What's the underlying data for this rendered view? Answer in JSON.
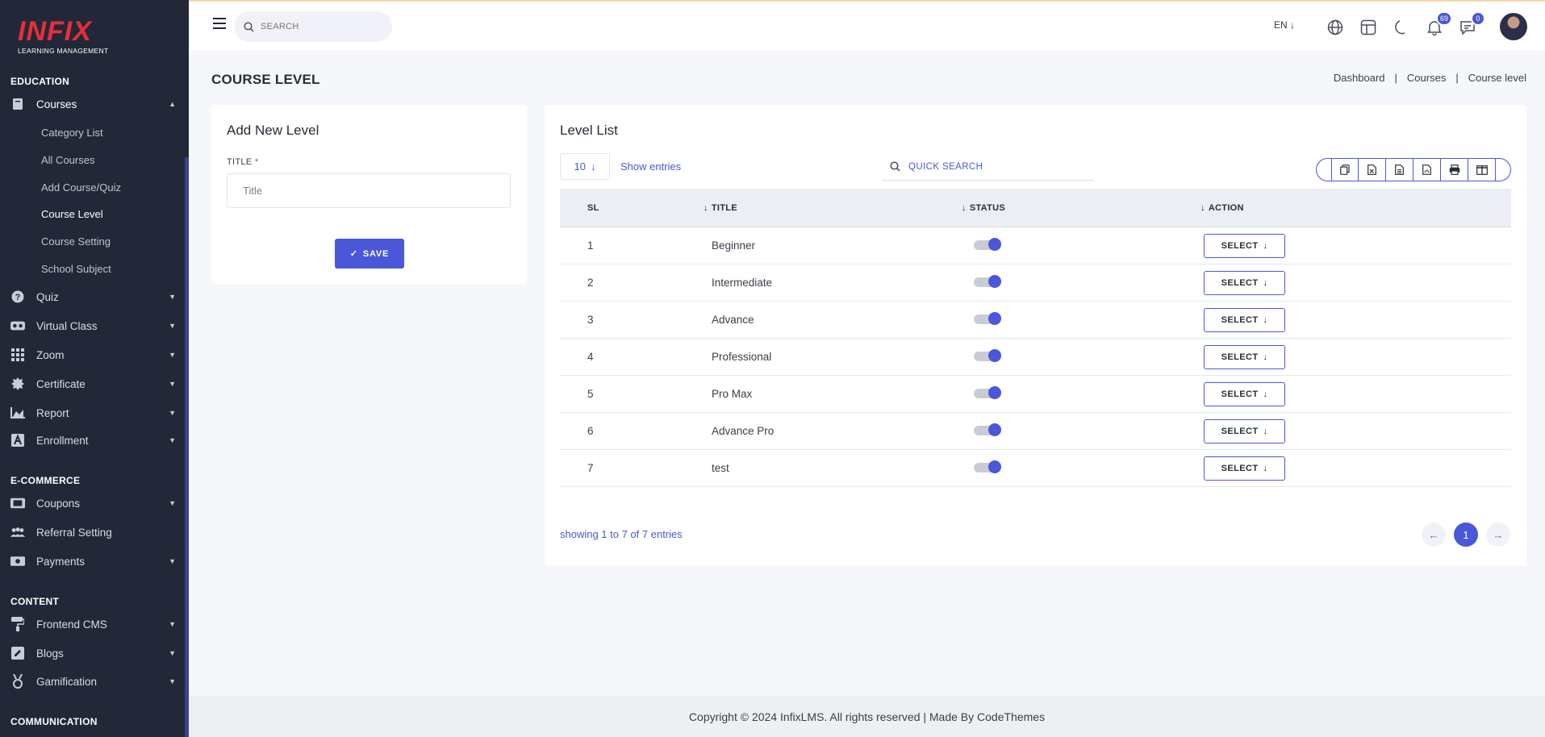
{
  "brand": {
    "logo": "INFIX",
    "tagline": "LEARNING MANAGEMENT",
    "accent": "#4a57d8",
    "logo_color": "#e52f3b"
  },
  "sidebar": {
    "sections": {
      "education": "EDUCATION",
      "ecommerce": "E-COMMERCE",
      "content": "CONTENT",
      "communication": "COMMUNICATION"
    },
    "courses": {
      "label": "Courses",
      "icon": "book-icon",
      "sub": [
        "Category List",
        "All Courses",
        "Add Course/Quiz",
        "Course Level",
        "Course Setting",
        "School Subject"
      ],
      "active": "Course Level"
    },
    "items": [
      {
        "label": "Quiz",
        "icon": "question-circle-icon"
      },
      {
        "label": "Virtual Class",
        "icon": "vr-glasses-icon"
      },
      {
        "label": "Zoom",
        "icon": "grid-icon"
      },
      {
        "label": "Certificate",
        "icon": "certificate-badge-icon"
      },
      {
        "label": "Report",
        "icon": "chart-icon"
      },
      {
        "label": "Enrollment",
        "icon": "enrollment-icon"
      },
      {
        "label": "Coupons",
        "icon": "ticket-icon"
      },
      {
        "label": "Referral Setting",
        "icon": "users-icon"
      },
      {
        "label": "Payments",
        "icon": "money-icon"
      },
      {
        "label": "Frontend CMS",
        "icon": "paint-roller-icon"
      },
      {
        "label": "Blogs",
        "icon": "edit-icon"
      },
      {
        "label": "Gamification",
        "icon": "medal-icon"
      }
    ]
  },
  "topbar": {
    "search_placeholder": "SEARCH",
    "lang": "EN",
    "notification_count": "69",
    "message_count": "0"
  },
  "page": {
    "title": "COURSE LEVEL",
    "breadcrumb": [
      "Dashboard",
      "Courses",
      "Course level"
    ]
  },
  "add_form": {
    "title": "Add New Level",
    "field_label": "TITLE",
    "required_mark": "*",
    "placeholder": "Title",
    "save_label": "SAVE"
  },
  "list": {
    "title": "Level List",
    "entries": "10",
    "show_entries": "Show entries",
    "search_placeholder": "QUICK SEARCH",
    "columns": {
      "sl": "SL",
      "title": "TITLE",
      "status": "STATUS",
      "action": "ACTION"
    },
    "rows": [
      {
        "sl": "1",
        "title": "Beginner",
        "active": true,
        "action": "SELECT"
      },
      {
        "sl": "2",
        "title": "Intermediate",
        "active": true,
        "action": "SELECT"
      },
      {
        "sl": "3",
        "title": "Advance",
        "active": true,
        "action": "SELECT"
      },
      {
        "sl": "4",
        "title": "Professional",
        "active": true,
        "action": "SELECT"
      },
      {
        "sl": "5",
        "title": "Pro Max",
        "active": true,
        "action": "SELECT"
      },
      {
        "sl": "6",
        "title": "Advance Pro",
        "active": true,
        "action": "SELECT"
      },
      {
        "sl": "7",
        "title": "test",
        "active": true,
        "action": "SELECT"
      }
    ],
    "showing": "showing 1 to 7 of 7 entries",
    "page": "1"
  },
  "footer": {
    "text": "Copyright © 2024 InfixLMS. All rights reserved | Made By CodeThemes"
  }
}
